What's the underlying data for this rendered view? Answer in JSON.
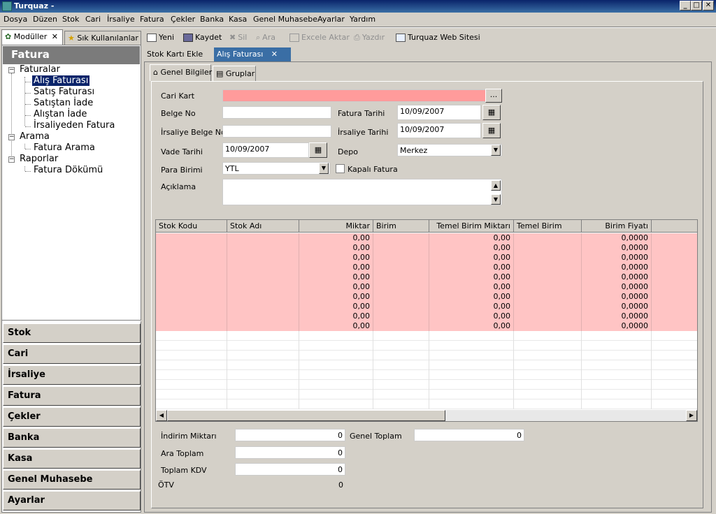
{
  "window": {
    "title": "Turquaz -",
    "min": "_",
    "max": "□",
    "close": "✕"
  },
  "menu": [
    "Dosya",
    "Düzen",
    "Stok",
    "Cari",
    "İrsaliye",
    "Fatura",
    "Çekler",
    "Banka",
    "Kasa",
    "Genel Muhasebe",
    "Ayarlar",
    "Yardım"
  ],
  "left_tabs": {
    "modules": "Modüller",
    "favorites": "Sık Kullanılanlar"
  },
  "panel_title": "Fatura",
  "tree": {
    "faturalar": "Faturalar",
    "alis": "Alış Faturası",
    "satis": "Satış Faturası",
    "satistan_iade": "Satıştan İade",
    "alistan_iade": "Alıştan İade",
    "irsaliyeden": "İrsaliyeden Fatura",
    "arama": "Arama",
    "fatura_arama": "Fatura Arama",
    "raporlar": "Raporlar",
    "fatura_dokumu": "Fatura Dökümü"
  },
  "modules": [
    "Stok",
    "Cari",
    "İrsaliye",
    "Fatura",
    "Çekler",
    "Banka",
    "Kasa",
    "Genel Muhasebe",
    "Ayarlar"
  ],
  "toolbar": {
    "new": "Yeni",
    "save": "Kaydet",
    "delete": "Sil",
    "search": "Ara",
    "excel": "Excele Aktar",
    "print": "Yazdır",
    "web": "Turquaz Web Sitesi"
  },
  "doc_tabs": {
    "stok": "Stok Kartı Ekle",
    "alis": "Alış Faturası"
  },
  "inner_tabs": {
    "general": "Genel Bilgiler",
    "groups": "Gruplar"
  },
  "form": {
    "cari_kart_label": "Cari Kart",
    "cari_btn": "...",
    "belge_no_label": "Belge No",
    "fatura_tarihi_label": "Fatura Tarihi",
    "fatura_tarihi": "10/09/2007",
    "irsaliye_belge_label": "İrsaliye Belge No",
    "irsaliye_tarihi_label": "İrsaliye Tarihi",
    "irsaliye_tarihi": "10/09/2007",
    "vade_tarihi_label": "Vade Tarihi",
    "vade_tarihi": "10/09/2007",
    "depo_label": "Depo",
    "depo": "Merkez",
    "para_birimi_label": "Para Birimi",
    "para_birimi": "YTL",
    "kapali_label": "Kapalı Fatura",
    "aciklama_label": "Açıklama"
  },
  "grid": {
    "headers": [
      "Stok Kodu",
      "Stok Adı",
      "Miktar",
      "Birim",
      "Temel Birim Miktarı",
      "Temel Birim",
      "Birim Fiyatı"
    ],
    "rows": [
      [
        "",
        "",
        "0,00",
        "",
        "0,00",
        "",
        "0,0000"
      ],
      [
        "",
        "",
        "0,00",
        "",
        "0,00",
        "",
        "0,0000"
      ],
      [
        "",
        "",
        "0,00",
        "",
        "0,00",
        "",
        "0,0000"
      ],
      [
        "",
        "",
        "0,00",
        "",
        "0,00",
        "",
        "0,0000"
      ],
      [
        "",
        "",
        "0,00",
        "",
        "0,00",
        "",
        "0,0000"
      ],
      [
        "",
        "",
        "0,00",
        "",
        "0,00",
        "",
        "0,0000"
      ],
      [
        "",
        "",
        "0,00",
        "",
        "0,00",
        "",
        "0,0000"
      ],
      [
        "",
        "",
        "0,00",
        "",
        "0,00",
        "",
        "0,0000"
      ],
      [
        "",
        "",
        "0,00",
        "",
        "0,00",
        "",
        "0,0000"
      ],
      [
        "",
        "",
        "0,00",
        "",
        "0,00",
        "",
        "0,0000"
      ]
    ],
    "row_color": "#ffc4c4"
  },
  "totals": {
    "indirim_label": "İndirim Miktarı",
    "indirim": "0",
    "ara_label": "Ara Toplam",
    "ara": "0",
    "kdv_label": "Toplam KDV",
    "kdv": "0",
    "otv_label": "ÖTV",
    "otv": "0",
    "genel_label": "Genel Toplam",
    "genel": "0"
  }
}
